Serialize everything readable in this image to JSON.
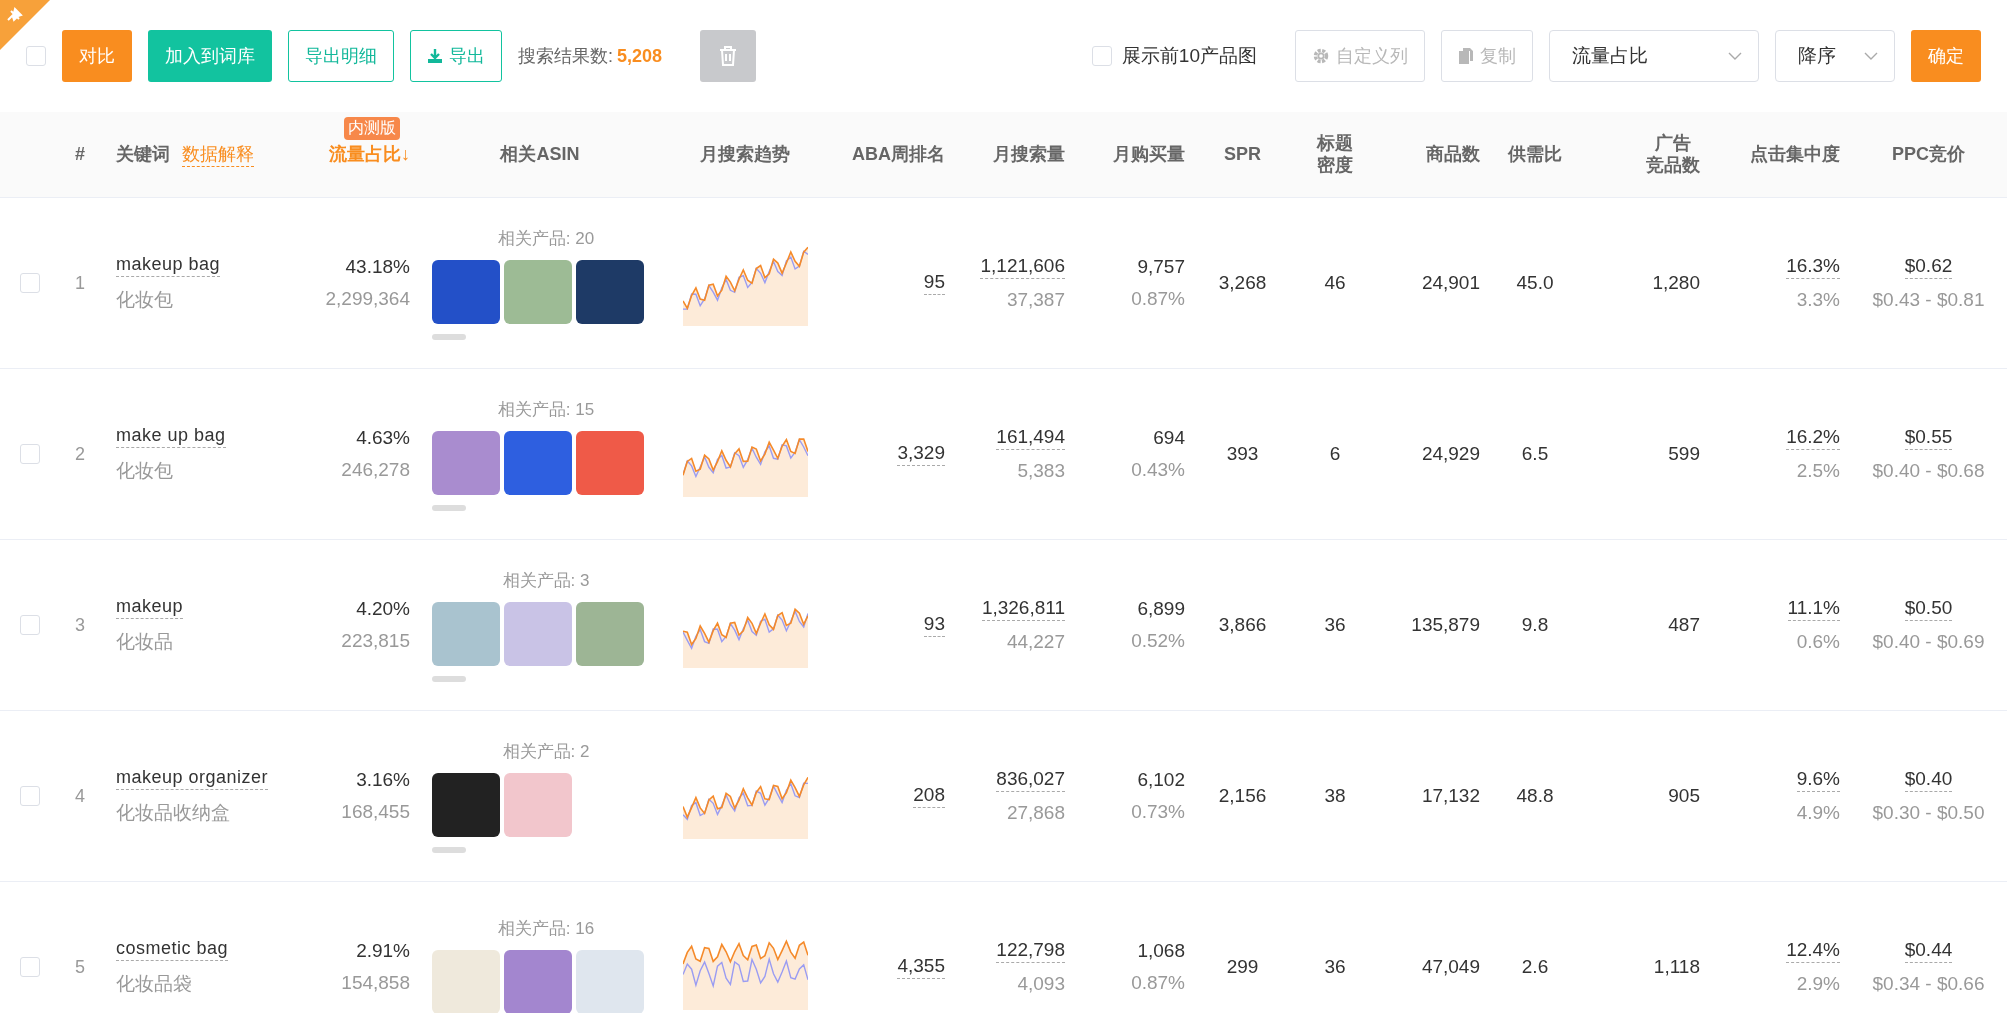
{
  "toolbar": {
    "select_all": {
      "checked": false
    },
    "buttons": [
      {
        "label": "对比",
        "kind": "accent"
      },
      {
        "label": "加入到词库",
        "kind": "primary"
      },
      {
        "label": "导出明细",
        "kind": "outline"
      },
      {
        "label": "导出",
        "kind": "download"
      }
    ],
    "result_label": "搜索结果数:",
    "result_count": "5,208",
    "delete_button": {
      "disabled": true
    },
    "show_images": {
      "label": "展示前10产品图",
      "checked": false
    },
    "custom_columns": {
      "label": "自定义列",
      "disabled": true
    },
    "copy": {
      "label": "复制",
      "disabled": true
    },
    "sort_field": {
      "value": "流量占比"
    },
    "sort_order": {
      "value": "降序"
    },
    "confirm": {
      "label": "确定"
    }
  },
  "table": {
    "columns": [
      {
        "label": "#",
        "sorted": false
      },
      {
        "label": "关键词",
        "sorted": false,
        "link": "数据解释"
      },
      {
        "label": "流量占比",
        "sorted": true,
        "badge": "内测版",
        "sort_arrow": "↓"
      },
      {
        "label": "相关ASIN",
        "sorted": false
      },
      {
        "label": "月搜索趋势",
        "sorted": false
      },
      {
        "label": "ABA周排名",
        "sorted": false
      },
      {
        "label": "月搜索量",
        "sorted": false
      },
      {
        "label": "月购买量",
        "sorted": false
      },
      {
        "label": "SPR",
        "sorted": false
      },
      {
        "lines": [
          "标题",
          "密度"
        ],
        "sorted": false
      },
      {
        "label": "商品数",
        "sorted": false
      },
      {
        "label": "供需比",
        "sorted": false
      },
      {
        "lines": [
          "广告",
          "竞品数"
        ],
        "sorted": false
      },
      {
        "label": "点击集中度",
        "sorted": false
      },
      {
        "label": "PPC竞价",
        "sorted": false
      }
    ],
    "rows": [
      {
        "checked": false,
        "index": "1",
        "keyword": "makeup bag",
        "translation": "化妆包",
        "share": "43.18%",
        "traffic": "2,299,364",
        "related": "相关产品: 20",
        "aba_rank": "95",
        "monthly_search": "1,121,606",
        "daily_search": "37,387",
        "monthly_purchase": "9,757",
        "purchase_rate": "0.87%",
        "spr": "3,268",
        "title_density": "46",
        "product_count": "24,901",
        "supply_ratio": "45.0",
        "ad_count": "1,280",
        "click_concentration": "16.3%",
        "click_sub": "3.3%",
        "ppc": "$0.62",
        "ppc_range": "$0.43 - $0.81"
      },
      {
        "checked": false,
        "index": "2",
        "keyword": "make up bag",
        "translation": "化妆包",
        "share": "4.63%",
        "traffic": "246,278",
        "related": "相关产品: 15",
        "aba_rank": "3,329",
        "monthly_search": "161,494",
        "daily_search": "5,383",
        "monthly_purchase": "694",
        "purchase_rate": "0.43%",
        "spr": "393",
        "title_density": "6",
        "product_count": "24,929",
        "supply_ratio": "6.5",
        "ad_count": "599",
        "click_concentration": "16.2%",
        "click_sub": "2.5%",
        "ppc": "$0.55",
        "ppc_range": "$0.40 - $0.68"
      },
      {
        "checked": false,
        "index": "3",
        "keyword": "makeup",
        "translation": "化妆品",
        "share": "4.20%",
        "traffic": "223,815",
        "related": "相关产品: 3",
        "aba_rank": "93",
        "monthly_search": "1,326,811",
        "daily_search": "44,227",
        "monthly_purchase": "6,899",
        "purchase_rate": "0.52%",
        "spr": "3,866",
        "title_density": "36",
        "product_count": "135,879",
        "supply_ratio": "9.8",
        "ad_count": "487",
        "click_concentration": "11.1%",
        "click_sub": "0.6%",
        "ppc": "$0.50",
        "ppc_range": "$0.40 - $0.69"
      },
      {
        "checked": false,
        "index": "4",
        "keyword": "makeup organizer",
        "translation": "化妆品收纳盒",
        "share": "3.16%",
        "traffic": "168,455",
        "related": "相关产品: 2",
        "aba_rank": "208",
        "monthly_search": "836,027",
        "daily_search": "27,868",
        "monthly_purchase": "6,102",
        "purchase_rate": "0.73%",
        "spr": "2,156",
        "title_density": "38",
        "product_count": "17,132",
        "supply_ratio": "48.8",
        "ad_count": "905",
        "click_concentration": "9.6%",
        "click_sub": "4.9%",
        "ppc": "$0.40",
        "ppc_range": "$0.30 - $0.50"
      },
      {
        "checked": false,
        "index": "5",
        "keyword": "cosmetic bag",
        "translation": "化妆品袋",
        "share": "2.91%",
        "traffic": "154,858",
        "related": "相关产品: 16",
        "aba_rank": "4,355",
        "monthly_search": "122,798",
        "daily_search": "4,093",
        "monthly_purchase": "1,068",
        "purchase_rate": "0.87%",
        "spr": "299",
        "title_density": "36",
        "product_count": "47,049",
        "supply_ratio": "2.6",
        "ad_count": "1,118",
        "click_concentration": "12.4%",
        "click_sub": "2.9%",
        "ppc": "$0.44",
        "ppc_range": "$0.34 - $0.66"
      }
    ]
  }
}
